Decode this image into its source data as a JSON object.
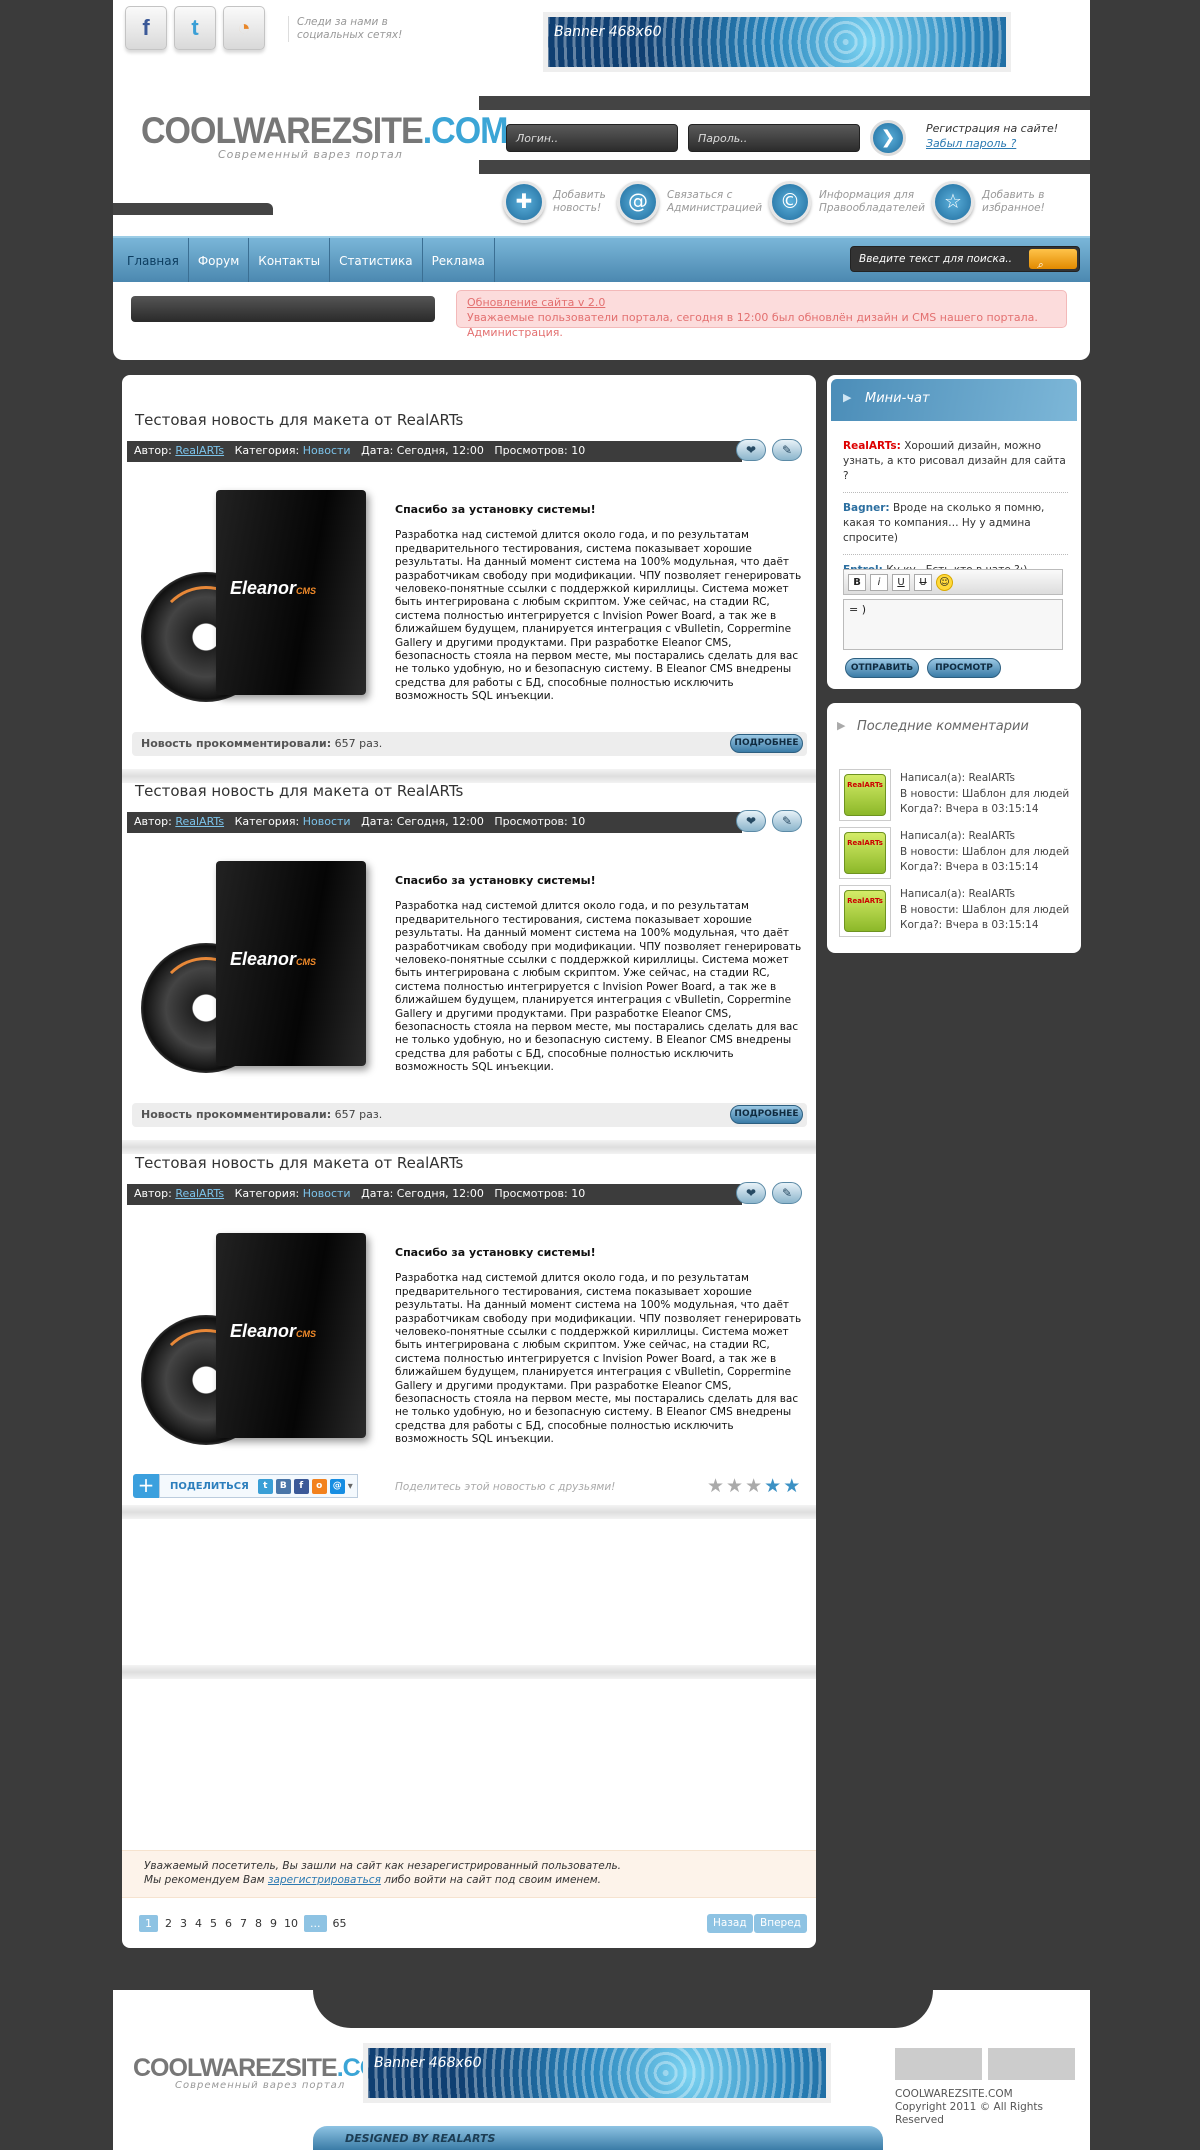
{
  "header": {
    "social_text": "Следи за нами в социальных сетях!",
    "banner_text": "Banner 468x60",
    "logo_main": "COOLWAREZSITE",
    "logo_tld": ".COM",
    "slogan": "Современный варез портал",
    "login_placeholder": "Логин..",
    "password_placeholder": "Пароль..",
    "register_text": "Регистрация на сайте!",
    "forgot_text": "Забыл пароль ?",
    "quick_icons": [
      {
        "icon": "plus-icon",
        "label": "Добавить новость!"
      },
      {
        "icon": "at-icon",
        "label": "Связаться с Администрацией"
      },
      {
        "icon": "copyright-icon",
        "label": "Информация для Правообладателей"
      },
      {
        "icon": "star-icon",
        "label": "Добавить в избранное!"
      }
    ]
  },
  "nav": {
    "items": [
      "Главная",
      "Форум",
      "Контакты",
      "Статистика",
      "Реклама"
    ],
    "search_placeholder": "Введите текст для поиска.."
  },
  "notice": {
    "title": "Обновление сайта v 2.0",
    "text": "Уважаемые пользователи портала, сегодня в 12:00 был обновлён дизайн и CMS нашего портала. Администрация."
  },
  "posts": [
    {
      "title": "Тестовая новость для макета от RealARTs",
      "author_label": "Автор:",
      "author": "RealARTs",
      "category_label": "Категория:",
      "category": "Новости",
      "date": "Дата: Сегодня, 12:00",
      "views": "Просмотров: 10",
      "heading": "Спасибо за установку системы!",
      "body": "Разработка над системой длится около года, и по результатам предварительного тестирования, система показывает хорошие результаты. На данный момент система на 100% модульная, что даёт разработчикам свободу при модификации. ЧПУ  позволяет генерировать человеко-понятные ссылки с поддержкой кириллицы. Система может быть интегрирована с любым скриптом. Уже сейчас, на стадии RC, система полностью интегрируется с Invision Power Board, а так же в ближайшем будущем, планируется интеграция с vBulletin, Coppermine Gallery и  другими продуктами. При разработке Eleanor CMS, безопасность стояла на первом месте, мы постарались сделать для вас не только удобную, но и безопасную систему. В Eleanor CMS внедрены средства для работы с БД, способные полностью исключить возможность SQL инъекции.",
      "comments_label": "Новость прокомментировали:",
      "comments_value": "657 раз.",
      "more": "ПОДРОБНЕЕ"
    },
    {
      "title": "Тестовая новость для макета от RealARTs",
      "author_label": "Автор:",
      "author": "RealARTs",
      "category_label": "Категория:",
      "category": "Новости",
      "date": "Дата: Сегодня, 12:00",
      "views": "Просмотров: 10",
      "heading": "Спасибо за установку системы!",
      "body": "Разработка над системой длится около года, и по результатам предварительного тестирования, система показывает хорошие результаты. На данный момент система на 100% модульная, что даёт разработчикам свободу при модификации. ЧПУ  позволяет генерировать человеко-понятные ссылки с поддержкой кириллицы. Система может быть интегрирована с любым скриптом. Уже сейчас, на стадии RC, система полностью интегрируется с Invision Power Board, а так же в ближайшем будущем, планируется интеграция с vBulletin, Coppermine Gallery и  другими продуктами. При разработке Eleanor CMS, безопасность стояла на первом месте, мы постарались сделать для вас не только удобную, но и безопасную систему. В Eleanor CMS внедрены средства для работы с БД, способные полностью исключить возможность SQL инъекции.",
      "comments_label": "Новость прокомментировали:",
      "comments_value": "657 раз.",
      "more": "ПОДРОБНЕЕ"
    },
    {
      "title": "Тестовая новость для макета от RealARTs",
      "author_label": "Автор:",
      "author": "RealARTs",
      "category_label": "Категория:",
      "category": "Новости",
      "date": "Дата: Сегодня, 12:00",
      "views": "Просмотров: 10",
      "heading": "Спасибо за установку системы!",
      "body": "Разработка над системой длится около года, и по результатам предварительного тестирования, система показывает хорошие результаты. На данный момент система на 100% модульная, что даёт разработчикам свободу при модификации. ЧПУ  позволяет генерировать человеко-понятные ссылки с поддержкой кириллицы. Система может быть интегрирована с любым скриптом. Уже сейчас, на стадии RC, система полностью интегрируется с Invision Power Board, а так же в ближайшем будущем, планируется интеграция с vBulletin, Coppermine Gallery и  другими продуктами. При разработке Eleanor CMS, безопасность стояла на первом месте, мы постарались сделать для вас не только удобную, но и безопасную систему. В Eleanor CMS внедрены средства для работы с БД, способные полностью исключить возможность SQL инъекции."
    }
  ],
  "product_logo": "Eleanor",
  "product_logo_sub": "CMS",
  "share": {
    "label": "ПОДЕЛИТЬСЯ",
    "text": "Поделитесь этой новостью с друзьями!",
    "rating_stars_filled": 2,
    "rating_stars_total": 5
  },
  "guest": {
    "line1": "Уважаемый посетитель, Вы зашли на сайт как незарегистрированный пользователь.",
    "line2_a": "Мы рекомендуем Вам",
    "line2_link": "зарегистрироваться",
    "line2_b": "либо войти на сайт под своим именем."
  },
  "pagination": {
    "pages": [
      "1",
      "2",
      "3",
      "4",
      "5",
      "6",
      "7",
      "8",
      "9",
      "10"
    ],
    "dots": "...",
    "last": "65",
    "prev": "Назад",
    "next": "Вперед"
  },
  "minichat": {
    "title": "Мини-чат",
    "messages": [
      {
        "name": "RealARTs:",
        "text": "Хороший дизайн, можно узнать, а кто рисовал дизайн для сайта ?"
      },
      {
        "name": "Bagner:",
        "text": "Вроде на сколько я помню, какая то компания… Ну у админа спросите)"
      },
      {
        "name": "Entrol:",
        "text": "Ку ку.. Есть кто в чате ?:)"
      }
    ],
    "input_value": "= )",
    "send": "ОТПРАВИТЬ",
    "preview": "ПРОСМОТР"
  },
  "comments": {
    "title": "Последние комментарии",
    "items": [
      {
        "author": "Написал(а): RealARTs",
        "news": "В новости: Шаблон для людей",
        "when": "Когда?: Вчера в 03:15:14"
      },
      {
        "author": "Написал(а): RealARTs",
        "news": "В новости: Шаблон для людей",
        "when": "Когда?: Вчера в 03:15:14"
      },
      {
        "author": "Написал(а): RealARTs",
        "news": "В новости: Шаблон для людей",
        "when": "Когда?: Вчера в 03:15:14"
      }
    ],
    "thumb_text": "RealARTs"
  },
  "footer": {
    "banner_text": "Banner 468x60",
    "copy_line1": "COOLWAREZSITE.COM",
    "copy_line2": "Copyright 2011 © All Rights Reserved",
    "designed": "DESIGNED BY REALARTS"
  },
  "colors": {
    "accent": "#3ba5d6",
    "nav": "#5a97bf",
    "notice": "#e37070",
    "background": "#3b3b3b"
  }
}
